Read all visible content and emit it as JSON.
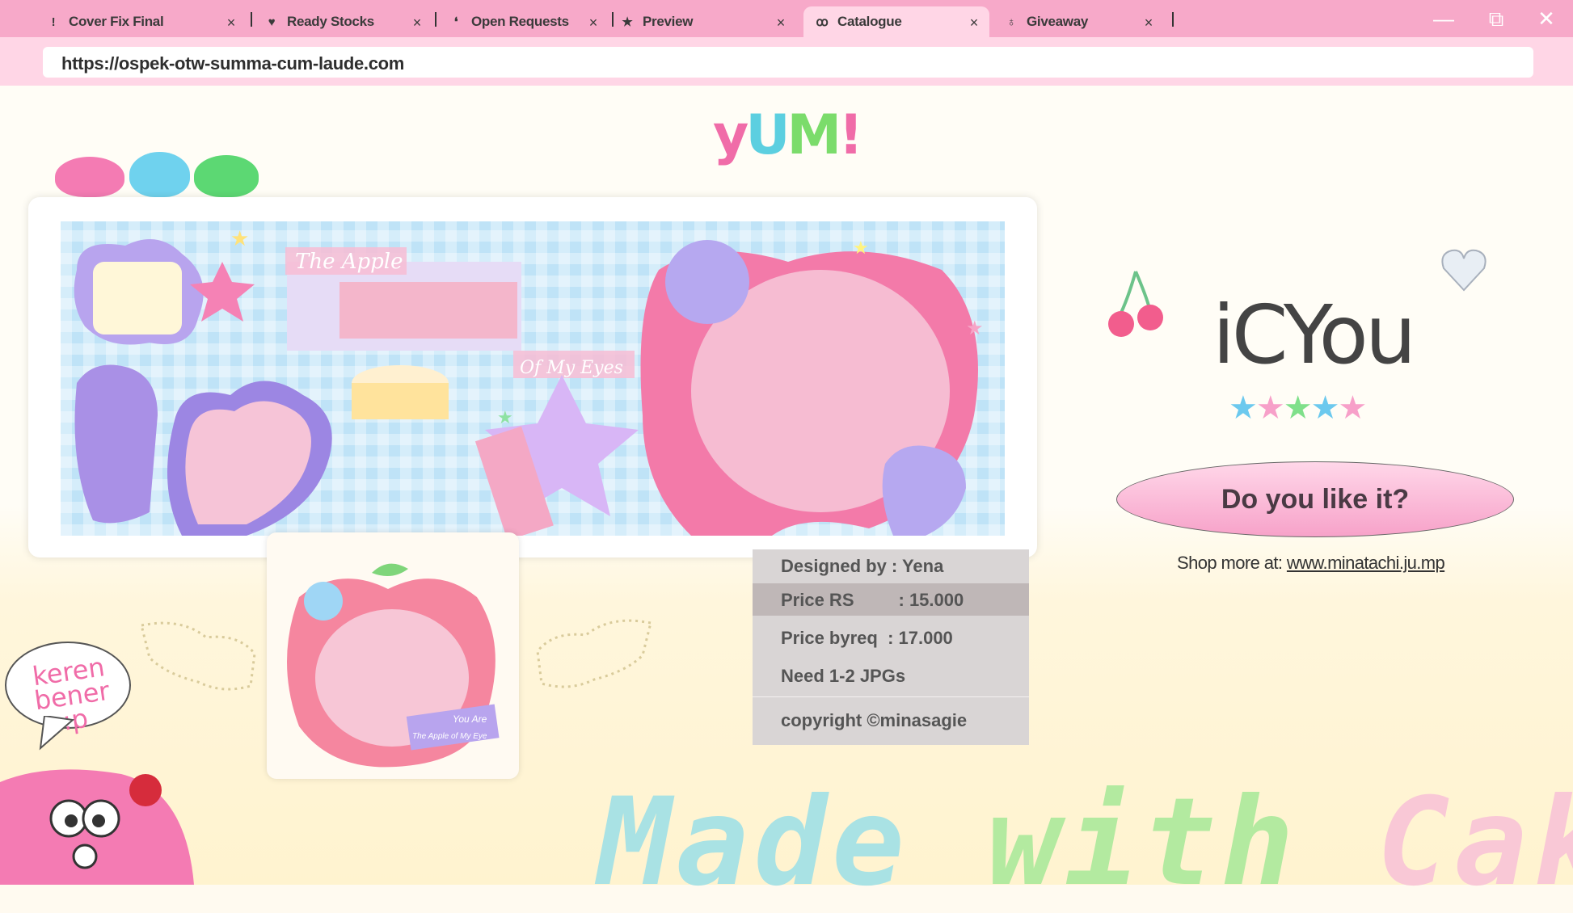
{
  "tabs": [
    {
      "icon": "!",
      "label": "Cover Fix Final"
    },
    {
      "icon": "♥",
      "label": "Ready Stocks"
    },
    {
      "icon": "❛",
      "label": "Open Requests"
    },
    {
      "icon": "★",
      "label": "Preview"
    },
    {
      "icon": "ꝏ",
      "label": "Catalogue"
    },
    {
      "icon": "♁",
      "label": "Giveaway"
    }
  ],
  "active_tab": "Catalogue",
  "tab_close": "×",
  "window_controls": {
    "minimize": "—",
    "maximize": "⧉",
    "close": "✕"
  },
  "address": "https://ospek-otw-summa-cum-laude.com",
  "logo": {
    "y": "y",
    "u": "U",
    "m": "M",
    "x": "!"
  },
  "banner": {
    "text1": "The Apple",
    "text2": "Of My Eyes"
  },
  "mini_card": {
    "caption1": "You Are",
    "caption2": "The Apple of My Eye"
  },
  "info": {
    "designed_by": "Designed by : Yena",
    "price_rs": "Price RS         : 15.000",
    "price_byreq": "Price byreq  : 17.000",
    "need": "Need 1-2 JPGs",
    "copyright": "copyright ©minasagie"
  },
  "product_title": "iCYou",
  "rating": {
    "stars": [
      "★",
      "★",
      "★",
      "★",
      "★"
    ],
    "colors": [
      "#6cc9ee",
      "#f7a0c9",
      "#7fe08a",
      "#6cc9ee",
      "#f7a0c9"
    ]
  },
  "like_button": "Do you like it?",
  "shop": {
    "prefix": "Shop more at: ",
    "link": "www.minatachi.ju.mp"
  },
  "speech": "keren bener :p",
  "footer": {
    "part1": "Made ",
    "part2": "with ",
    "part3": "Cak"
  },
  "colors": {
    "tabbar": "#f7a9c9",
    "addrrow": "#ffd6e6",
    "accent_pink": "#f06ca8",
    "info_bg": "#d9d5d5"
  }
}
